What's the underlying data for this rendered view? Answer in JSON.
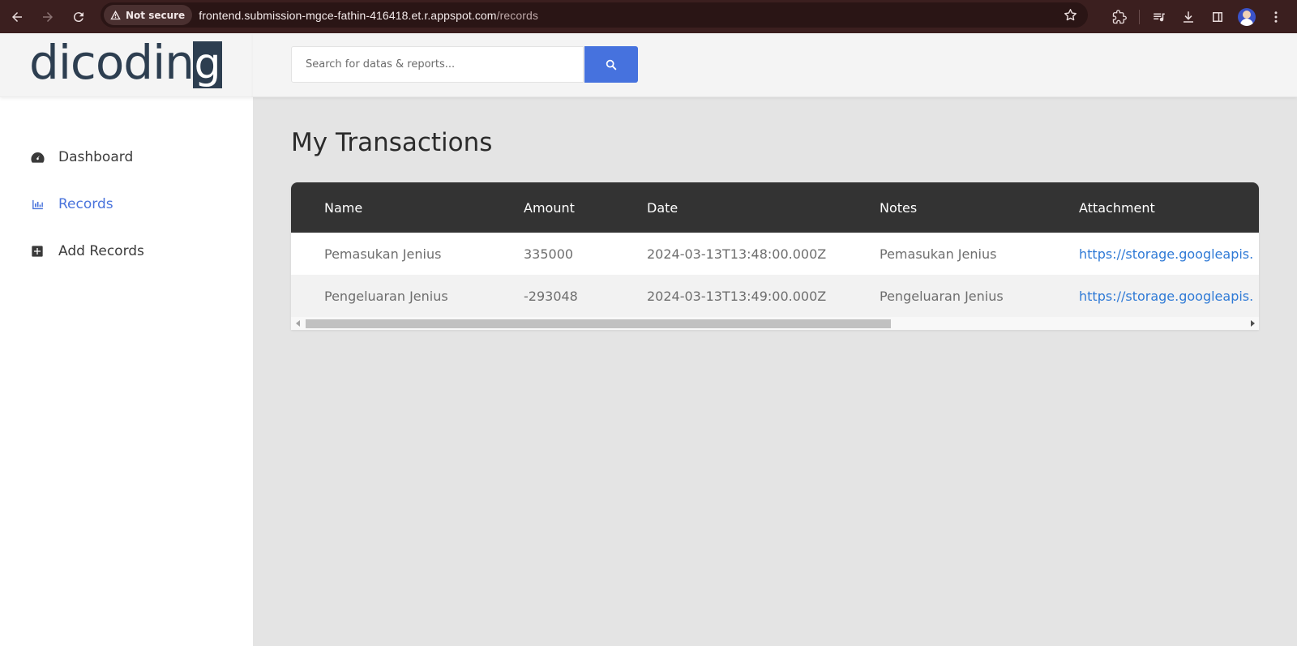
{
  "browser": {
    "security_label": "Not secure",
    "url_host": "frontend.submission-mgce-fathin-416418.et.r.appspot.com",
    "url_path": "/records"
  },
  "app": {
    "logo_text": "dicodin",
    "logo_last_letter": "g",
    "search": {
      "placeholder": "Search for datas & reports..."
    },
    "nav": [
      {
        "label": "Dashboard",
        "icon": "dashboard-gauge-icon"
      },
      {
        "label": "Records",
        "icon": "bar-chart-icon",
        "active": true
      },
      {
        "label": "Add Records",
        "icon": "plus-square-icon"
      }
    ],
    "page_title": "My Transactions",
    "table": {
      "columns": [
        "Name",
        "Amount",
        "Date",
        "Notes",
        "Attachment"
      ],
      "rows": [
        {
          "name": "Pemasukan Jenius",
          "amount": "335000",
          "date": "2024-03-13T13:48:00.000Z",
          "notes": "Pemasukan Jenius",
          "attachment": "https://storage.googleapis."
        },
        {
          "name": "Pengeluaran Jenius",
          "amount": "-293048",
          "date": "2024-03-13T13:49:00.000Z",
          "notes": "Pengeluaran Jenius",
          "attachment": "https://storage.googleapis."
        }
      ]
    }
  },
  "colors": {
    "accent": "#4672de",
    "active_nav": "#4a74dc",
    "table_header": "#333333",
    "link": "#2f7ad6",
    "browser_bar": "#3b1f1f"
  }
}
